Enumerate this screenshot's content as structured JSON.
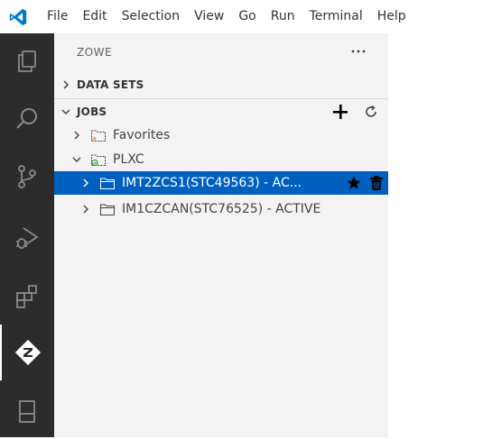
{
  "menu": {
    "items": [
      "File",
      "Edit",
      "Selection",
      "View",
      "Go",
      "Run",
      "Terminal",
      "Help"
    ]
  },
  "activity_bar": {
    "items": [
      {
        "name": "explorer-icon"
      },
      {
        "name": "search-icon"
      },
      {
        "name": "source-control-icon"
      },
      {
        "name": "run-debug-icon"
      },
      {
        "name": "extensions-icon"
      },
      {
        "name": "zowe-icon",
        "active": true
      },
      {
        "name": "remote-explorer-icon"
      }
    ]
  },
  "sidebar": {
    "title": "ZOWE",
    "more_actions": "...",
    "sections": {
      "datasets": {
        "label": "DATA SETS",
        "expanded": false
      },
      "jobs": {
        "label": "JOBS",
        "expanded": true
      }
    },
    "tree": {
      "favorites": "Favorites",
      "profile": "PLXC",
      "jobs": [
        {
          "label": "IMT2ZCS1(STC49563) - AC...",
          "selected": true
        },
        {
          "label": "IM1CZCAN(STC76525) - ACTIVE",
          "selected": false
        }
      ]
    }
  },
  "colors": {
    "activity_bar_bg": "#2c2c2c",
    "sidebar_bg": "#f3f3f3",
    "selection_bg": "#0060c0",
    "vscode_blue": "#007acc",
    "favorite_star": "#e8a33d",
    "connected_green": "#388a34"
  }
}
